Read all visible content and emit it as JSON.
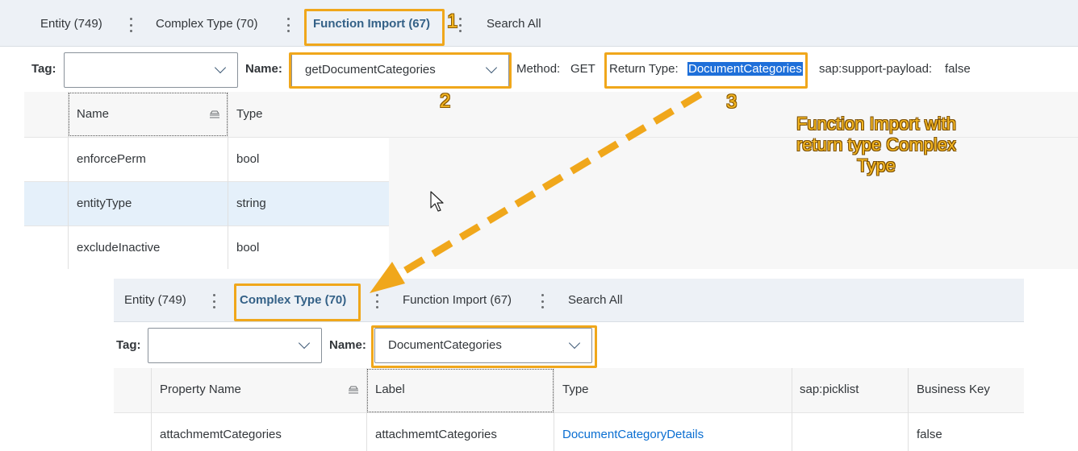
{
  "top": {
    "tabs": [
      {
        "label": "Entity (749)",
        "active": false
      },
      {
        "label": "Complex Type (70)",
        "active": false
      },
      {
        "label": "Function Import (67)",
        "active": true
      },
      {
        "label": "Search All",
        "active": false
      }
    ],
    "filter": {
      "tag_label": "Tag:",
      "tag_value": "",
      "name_label": "Name:",
      "name_value": "getDocumentCategories",
      "method_label": "Method:",
      "method_value": "GET",
      "return_type_label": "Return Type:",
      "return_type_value": "DocumentCategories",
      "payload_label": "sap:support-payload:",
      "payload_value": "false"
    },
    "table": {
      "columns": [
        "Name",
        "Type"
      ],
      "rows": [
        [
          "enforcePerm",
          "bool"
        ],
        [
          "entityType",
          "string"
        ],
        [
          "excludeInactive",
          "bool"
        ]
      ]
    }
  },
  "bottom": {
    "tabs": [
      {
        "label": "Entity (749)",
        "active": false
      },
      {
        "label": "Complex Type (70)",
        "active": true
      },
      {
        "label": "Function Import (67)",
        "active": false
      },
      {
        "label": "Search All",
        "active": false
      }
    ],
    "filter": {
      "tag_label": "Tag:",
      "tag_value": "",
      "name_label": "Name:",
      "name_value": "DocumentCategories"
    },
    "table": {
      "columns": [
        "Property Name",
        "Label",
        "Type",
        "sap:picklist",
        "Business Key"
      ],
      "rows": [
        [
          "attachmemtCategories",
          "attachmemtCategories",
          "DocumentCategoryDetails",
          "",
          "false"
        ]
      ]
    }
  },
  "annotations": {
    "step1": "1",
    "step2": "2",
    "step3": "3",
    "callout": "Function Import with return type Complex Type"
  },
  "colors": {
    "accent": "#346187",
    "annotation": "#f0a71b",
    "link": "#0a6ed1",
    "selected_row": "#e5f0fa",
    "text_highlight": "#1e6fd9"
  }
}
